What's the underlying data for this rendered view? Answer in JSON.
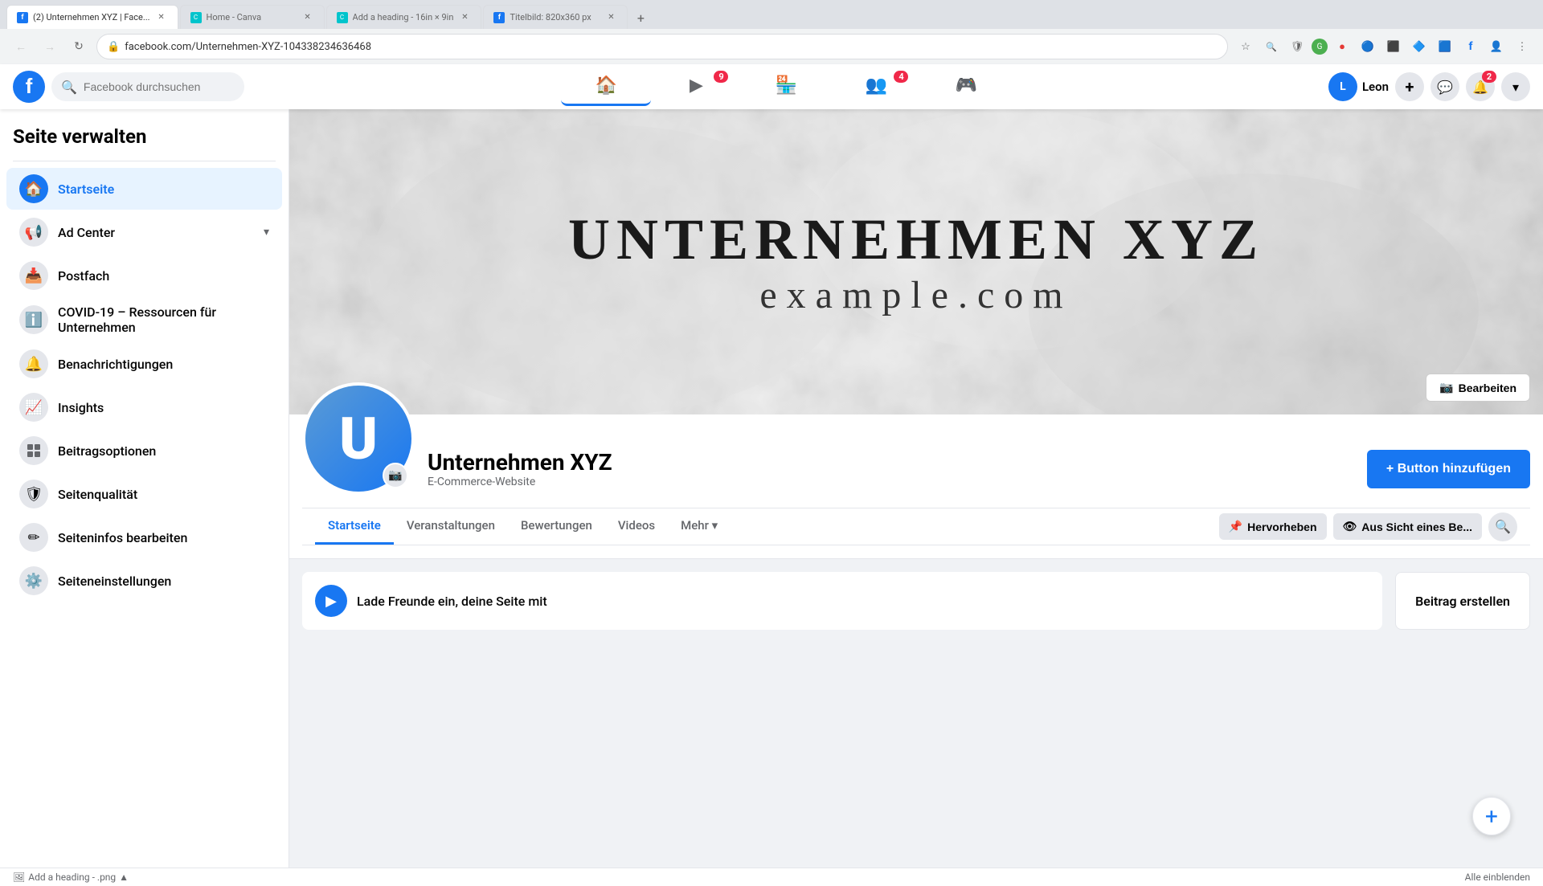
{
  "browser": {
    "tabs": [
      {
        "id": "tab1",
        "title": "(2) Unternehmen XYZ | Face...",
        "active": true,
        "favicon_color": "#1877f2"
      },
      {
        "id": "tab2",
        "title": "Home - Canva",
        "active": false,
        "favicon_color": "#00c4cc"
      },
      {
        "id": "tab3",
        "title": "Add a heading - 16in × 9in",
        "active": false,
        "favicon_color": "#00c4cc"
      },
      {
        "id": "tab4",
        "title": "Titelbild: 820x360 px",
        "active": false,
        "favicon_color": "#1877f2"
      }
    ],
    "url": "facebook.com/Unternehmen-XYZ-104338234636468"
  },
  "fb_header": {
    "search_placeholder": "Facebook durchsuchen",
    "user": {
      "name": "Leon",
      "initial": "L"
    },
    "nav_items": [
      {
        "id": "home",
        "icon": "🏠",
        "active": true
      },
      {
        "id": "watch",
        "icon": "▶",
        "badge": 9
      },
      {
        "id": "marketplace",
        "icon": "🏪"
      },
      {
        "id": "groups",
        "icon": "👥",
        "badge": 4
      },
      {
        "id": "gaming",
        "icon": "🎮"
      }
    ],
    "right_buttons": [
      {
        "id": "add",
        "icon": "+"
      },
      {
        "id": "messenger",
        "icon": "💬"
      },
      {
        "id": "notifications",
        "icon": "🔔",
        "badge": 2
      },
      {
        "id": "dropdown",
        "icon": "▾"
      }
    ]
  },
  "sidebar": {
    "title": "Seite verwalten",
    "items": [
      {
        "id": "startseite",
        "label": "Startseite",
        "icon": "🏠",
        "active": true
      },
      {
        "id": "adcenter",
        "label": "Ad Center",
        "icon": "📢",
        "has_chevron": true
      },
      {
        "id": "postfach",
        "label": "Postfach",
        "icon": "📥"
      },
      {
        "id": "covid",
        "label": "COVID-19 – Ressourcen für Unternehmen",
        "icon": "ℹ️"
      },
      {
        "id": "notifications",
        "label": "Benachrichtigungen",
        "icon": "🔔"
      },
      {
        "id": "insights",
        "label": "Insights",
        "icon": "📈"
      },
      {
        "id": "beitragsoptionen",
        "label": "Beitragsoptionen",
        "icon": "⚙"
      },
      {
        "id": "seitenqualitaet",
        "label": "Seitenqualität",
        "icon": "🛡"
      },
      {
        "id": "seiteninfos",
        "label": "Seiteninfos bearbeiten",
        "icon": "✏"
      },
      {
        "id": "seiteneinstellungen",
        "label": "Seiteneinstellungen",
        "icon": "⚙️"
      }
    ]
  },
  "page": {
    "cover_title": "UNTERNEHMEN XYZ",
    "cover_subtitle": "example.com",
    "cover_edit_label": "Bearbeiten",
    "profile_initial": "U",
    "name": "Unternehmen XYZ",
    "category": "E-Commerce-Website",
    "add_button_label": "+ Button hinzufügen",
    "tabs": [
      {
        "id": "startseite",
        "label": "Startseite",
        "active": true
      },
      {
        "id": "veranstaltungen",
        "label": "Veranstaltungen"
      },
      {
        "id": "bewertungen",
        "label": "Bewertungen"
      },
      {
        "id": "videos",
        "label": "Videos"
      },
      {
        "id": "mehr",
        "label": "Mehr ▾"
      }
    ],
    "tab_actions": [
      {
        "id": "hervorheben",
        "label": "Hervorheben",
        "icon": "📌"
      },
      {
        "id": "aussicht",
        "label": "Aus Sicht eines Be...",
        "icon": "👁"
      }
    ],
    "invite_text": "Lade Freunde ein, deine Seite mit",
    "beitrag_label": "Beitrag erstellen"
  },
  "bottom_bar": {
    "label": "Add a heading - .png",
    "icon": "🖼"
  }
}
